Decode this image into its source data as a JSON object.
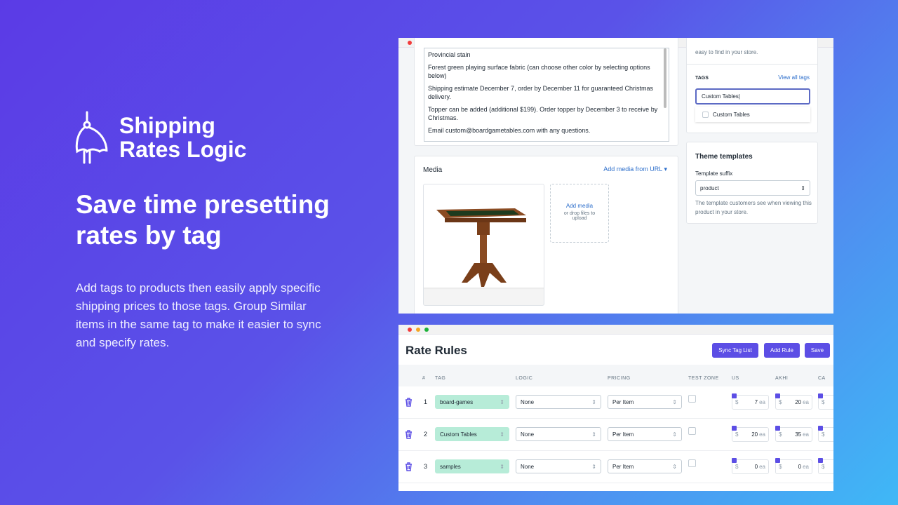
{
  "brand": {
    "name_line1": "Shipping",
    "name_line2": "Rates Logic",
    "icon": "crane-hook-icon"
  },
  "headline": "Save time presetting rates by tag",
  "description": "Add tags to products then easily apply specific shipping prices to those tags. Group Similar items in the same tag to make it easier to sync and specify rates.",
  "product_window": {
    "description_lines": [
      "Provincial stain",
      "Forest green playing surface fabric (can choose other color by selecting options below)",
      "Shipping estimate December 7, order by December 11 for guaranteed Christmas delivery.",
      "Topper can be added (additional $199). Order topper by December 3 to receive by Christmas.",
      "Email custom@boardgametables.com with any questions."
    ],
    "media": {
      "title": "Media",
      "add_url": "Add media from URL",
      "add_media": "Add media",
      "drop_hint": "or drop files to upload"
    },
    "organization_hint": "easy to find in your store.",
    "tags": {
      "label": "TAGS",
      "view_all": "View all tags",
      "input_value": "Custom Tables",
      "suggestion": "Custom Tables"
    },
    "theme": {
      "title": "Theme templates",
      "suffix_label": "Template suffix",
      "suffix_value": "product",
      "help": "The template customers see when viewing this product in your store."
    }
  },
  "rate_window": {
    "title": "Rate Rules",
    "buttons": {
      "sync": "Sync Tag List",
      "add": "Add Rule",
      "save": "Save"
    },
    "columns": [
      "#",
      "TAG",
      "LOGIC",
      "PRICING",
      "TEST ZONE",
      "US",
      "AKHI",
      "CA"
    ],
    "currency": "$",
    "unit": "ea",
    "rows": [
      {
        "n": "1",
        "tag": "board-games",
        "logic": "None",
        "pricing": "Per Item",
        "us": "7",
        "akhi": "20"
      },
      {
        "n": "2",
        "tag": "Custom Tables",
        "logic": "None",
        "pricing": "Per Item",
        "us": "20",
        "akhi": "35"
      },
      {
        "n": "3",
        "tag": "samples",
        "logic": "None",
        "pricing": "Per Item",
        "us": "0",
        "akhi": "0"
      }
    ]
  },
  "colors": {
    "accent": "#5c4ee5",
    "tag_green": "#b7ecd8",
    "link": "#2c6ecb"
  }
}
